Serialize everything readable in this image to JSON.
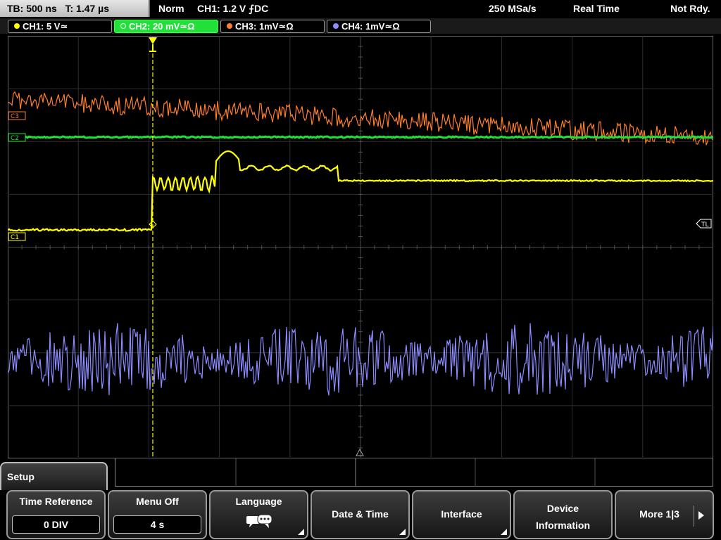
{
  "topbar": {
    "timebase": "TB: 500 ns",
    "trigger_time": "T: 1.47 µs",
    "mode": "Norm",
    "trigger_info": "CH1: 1.2 V ⨍DC",
    "sample_rate": "250 MSa/s",
    "acq_mode": "Real Time",
    "status": "Not Rdy."
  },
  "channels": [
    {
      "label": "CH1: 5 V≃",
      "color": "#ffff00",
      "active": false
    },
    {
      "label": "CH2: 20 mV≃Ω",
      "color": "#22e03a",
      "active": true
    },
    {
      "label": "CH3: 1mV≃Ω",
      "color": "#ff7f2a",
      "active": false
    },
    {
      "label": "CH4: 1mV≃Ω",
      "color": "#8c8cff",
      "active": false
    }
  ],
  "markers": {
    "ch3": "C3",
    "ch2": "C2",
    "ch1": "C1",
    "trigger_level": "TL"
  },
  "menu": {
    "title": "Setup",
    "softkeys": [
      {
        "label": "Time Reference",
        "value": "0 DIV"
      },
      {
        "label": "Menu Off",
        "value": "4 s"
      },
      {
        "label": "Language"
      },
      {
        "label": "Date & Time"
      },
      {
        "label": "Interface"
      },
      {
        "label_line1": "Device",
        "label_line2": "Information"
      },
      {
        "label": "More 1|3"
      }
    ]
  },
  "icons": {
    "trigger_position": "trigger-position-icon",
    "language": "speech-bubble-icon",
    "more": "arrow-right-icon"
  }
}
